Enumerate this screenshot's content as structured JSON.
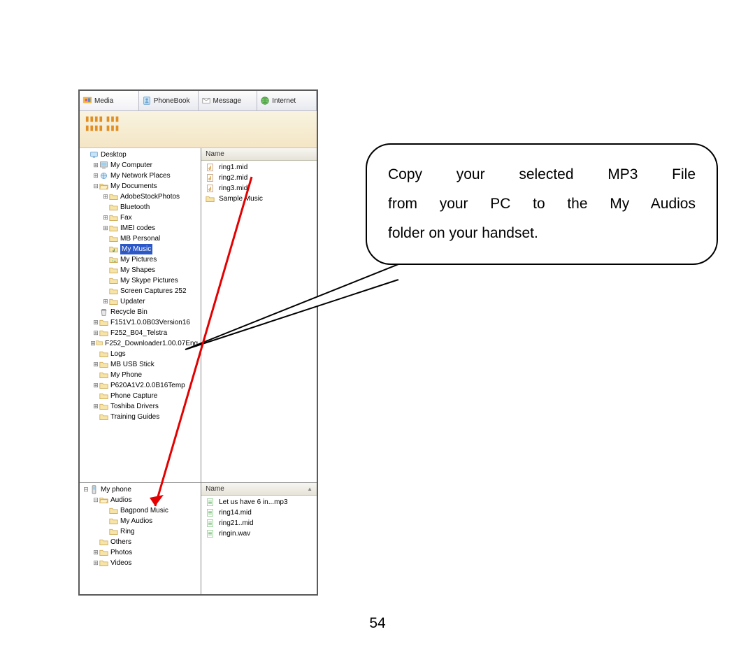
{
  "pageNumber": "54",
  "callout": {
    "line1": "Copy  your  selected  MP3  File",
    "line2": "from your PC to the My Audios",
    "line3": "folder on your handset."
  },
  "tabs": [
    {
      "label": "Media",
      "active": true
    },
    {
      "label": "PhoneBook",
      "active": false
    },
    {
      "label": "Message",
      "active": false
    },
    {
      "label": "Internet",
      "active": false
    }
  ],
  "top": {
    "treeHeader": "Desktop",
    "listHeader": "Name",
    "tree": [
      {
        "indent": 0,
        "toggle": "",
        "icon": "desktop",
        "label": "Desktop"
      },
      {
        "indent": 1,
        "toggle": "+",
        "icon": "computer",
        "label": "My Computer"
      },
      {
        "indent": 1,
        "toggle": "+",
        "icon": "netplaces",
        "label": "My Network Places"
      },
      {
        "indent": 1,
        "toggle": "-",
        "icon": "folder-open",
        "label": "My Documents"
      },
      {
        "indent": 2,
        "toggle": "+",
        "icon": "folder",
        "label": "AdobeStockPhotos"
      },
      {
        "indent": 2,
        "toggle": "",
        "icon": "folder",
        "label": "Bluetooth"
      },
      {
        "indent": 2,
        "toggle": "+",
        "icon": "folder",
        "label": "Fax"
      },
      {
        "indent": 2,
        "toggle": "+",
        "icon": "folder",
        "label": "IMEI codes"
      },
      {
        "indent": 2,
        "toggle": "",
        "icon": "folder",
        "label": "MB Personal"
      },
      {
        "indent": 2,
        "toggle": "",
        "icon": "folder-music",
        "label": "My Music",
        "selected": true
      },
      {
        "indent": 2,
        "toggle": "",
        "icon": "folder-pics",
        "label": "My Pictures"
      },
      {
        "indent": 2,
        "toggle": "",
        "icon": "folder",
        "label": "My Shapes"
      },
      {
        "indent": 2,
        "toggle": "",
        "icon": "folder",
        "label": "My Skype Pictures"
      },
      {
        "indent": 2,
        "toggle": "",
        "icon": "folder",
        "label": "Screen Captures 252"
      },
      {
        "indent": 2,
        "toggle": "+",
        "icon": "folder",
        "label": "Updater"
      },
      {
        "indent": 1,
        "toggle": "",
        "icon": "recycle",
        "label": "Recycle Bin"
      },
      {
        "indent": 1,
        "toggle": "+",
        "icon": "folder",
        "label": "F151V1.0.0B03Version16"
      },
      {
        "indent": 1,
        "toggle": "+",
        "icon": "folder",
        "label": "F252_B04_Telstra"
      },
      {
        "indent": 1,
        "toggle": "+",
        "icon": "folder",
        "label": "F252_Downloader1.00.07Eng"
      },
      {
        "indent": 1,
        "toggle": "",
        "icon": "folder",
        "label": "Logs"
      },
      {
        "indent": 1,
        "toggle": "+",
        "icon": "folder",
        "label": "MB USB Stick"
      },
      {
        "indent": 1,
        "toggle": "",
        "icon": "folder",
        "label": "My Phone"
      },
      {
        "indent": 1,
        "toggle": "+",
        "icon": "folder",
        "label": "P620A1V2.0.0B16Temp"
      },
      {
        "indent": 1,
        "toggle": "",
        "icon": "folder",
        "label": "Phone Capture"
      },
      {
        "indent": 1,
        "toggle": "+",
        "icon": "folder",
        "label": "Toshiba Drivers"
      },
      {
        "indent": 1,
        "toggle": "",
        "icon": "folder",
        "label": "Training Guides"
      }
    ],
    "files": [
      {
        "icon": "midi",
        "label": "ring1.mid"
      },
      {
        "icon": "midi",
        "label": "ring2.mid"
      },
      {
        "icon": "midi",
        "label": "ring3.mid"
      },
      {
        "icon": "folder",
        "label": "Sample Music"
      }
    ]
  },
  "bottom": {
    "treeRoot": "My phone",
    "listHeader": "Name",
    "tree": [
      {
        "indent": 0,
        "toggle": "-",
        "icon": "phone",
        "label": "My phone"
      },
      {
        "indent": 1,
        "toggle": "-",
        "icon": "folder-open",
        "label": "Audios"
      },
      {
        "indent": 2,
        "toggle": "",
        "icon": "folder",
        "label": "Bagpond Music"
      },
      {
        "indent": 2,
        "toggle": "",
        "icon": "folder",
        "label": "My Audios"
      },
      {
        "indent": 2,
        "toggle": "",
        "icon": "folder",
        "label": "Ring"
      },
      {
        "indent": 1,
        "toggle": "",
        "icon": "folder",
        "label": "Others"
      },
      {
        "indent": 1,
        "toggle": "+",
        "icon": "folder",
        "label": "Photos"
      },
      {
        "indent": 1,
        "toggle": "+",
        "icon": "folder",
        "label": "Videos"
      }
    ],
    "files": [
      {
        "icon": "audio",
        "label": "Let us have 6 in...mp3"
      },
      {
        "icon": "audio",
        "label": "ring14.mid"
      },
      {
        "icon": "audio",
        "label": "ring21..mid"
      },
      {
        "icon": "audio",
        "label": "ringin.wav"
      }
    ]
  }
}
